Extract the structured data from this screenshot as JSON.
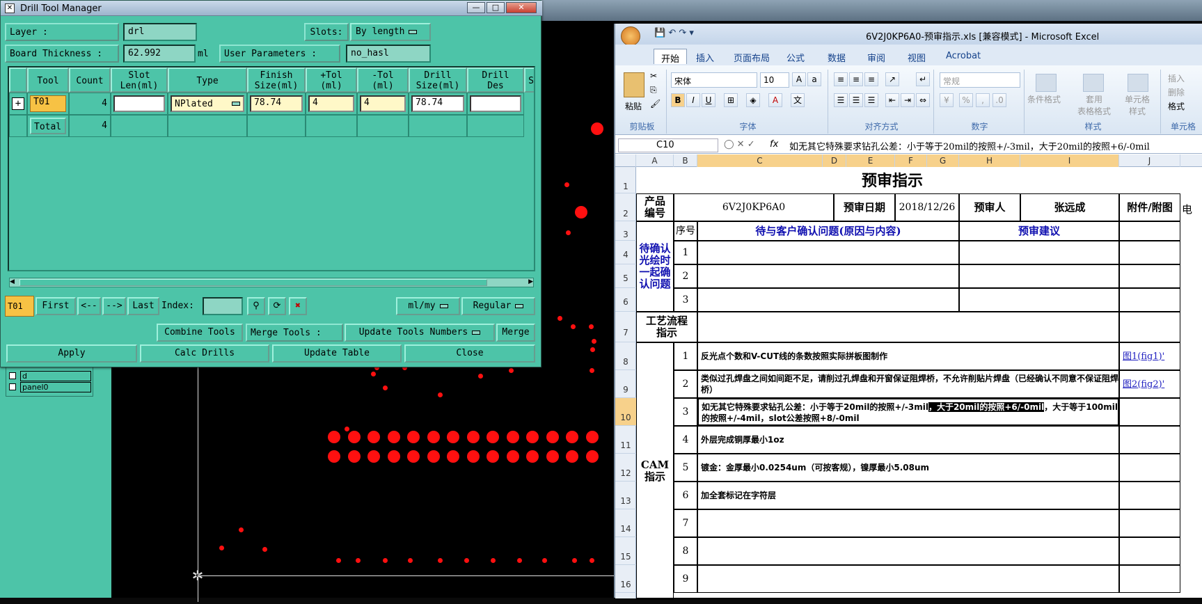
{
  "drill": {
    "title": "Drill Tool Manager",
    "minimize": "—",
    "maximize": "□",
    "close": "✕",
    "layer_label": "Layer        :",
    "layer_value": "drl",
    "slots_label": "Slots:",
    "slots_value": "By length",
    "thickness_label": "Board Thickness :",
    "thickness_value": "62.992",
    "thickness_unit": "ml",
    "userparams_label": "User Parameters :",
    "userparams_value": "no_hasl",
    "columns": [
      "Tool",
      "Count",
      "Slot\nLen(ml)",
      "Type",
      "Finish\nSize(ml)",
      "+Tol\n(ml)",
      "-Tol\n(ml)",
      "Drill\nSize(ml)",
      "Drill\nDes",
      "S"
    ],
    "row1": {
      "tool": "T01",
      "count": "4",
      "slot_len": "",
      "type": "NPlated",
      "finish": "78.74",
      "ptol": "4",
      "mtol": "4",
      "drill": "78.74",
      "des": ""
    },
    "total_label": "Total",
    "total_count": "4",
    "current": "T01",
    "first": "First",
    "prev": "<--",
    "next": "-->",
    "last": "Last",
    "index_label": "Index:",
    "units": "ml/my",
    "mode": "Regular",
    "combine": "Combine Tools",
    "merge_label": "Merge Tools :",
    "update_numbers": "Update Tools Numbers",
    "merge": "Merge",
    "apply": "Apply",
    "calc": "Calc Drills",
    "update_table": "Update Table",
    "close_btn": "Close"
  },
  "layers": {
    "items": [
      "d",
      "panel0"
    ]
  },
  "excel": {
    "title": "6V2J0KP6A0-预审指示.xls  [兼容模式] - Microsoft Excel",
    "tabs": [
      "开始",
      "插入",
      "页面布局",
      "公式",
      "数据",
      "审阅",
      "视图",
      "Acrobat"
    ],
    "font": "宋体",
    "size": "10",
    "number_format": "常规",
    "groups": [
      "剪贴板",
      "字体",
      "对齐方式",
      "数字",
      "样式",
      "单元格"
    ],
    "paste": "粘贴",
    "cond_format": "条件格式",
    "table_format": "套用\n表格格式",
    "cell_style": "单元格\n样式",
    "insert": "插入",
    "delete": "删除",
    "format": "格式",
    "e_label": "电",
    "name_box": "C10",
    "fx": "fx",
    "formula": "如无其它特殊要求钻孔公差：小于等于20mil的按照+/-3mil，大于20mil的按照+6/-0mil",
    "cols": [
      "A",
      "B",
      "C",
      "D",
      "E",
      "F",
      "G",
      "H",
      "I",
      "J"
    ],
    "rows": [
      "1",
      "2",
      "3",
      "4",
      "5",
      "6",
      "7",
      "8",
      "9",
      "10",
      "11",
      "12",
      "13",
      "14",
      "15",
      "16"
    ],
    "sheet": {
      "heading": "预审指示",
      "product_label": "产品\n编号",
      "product_no": "6V2J0KP6A0",
      "date_label": "预审日期",
      "date": "2018/12/26",
      "reviewer_label": "预审人",
      "reviewer": "张远成",
      "attach_label": "附件/附图",
      "seq": "序号",
      "question": "待与客户确认问题(原因与内容)",
      "suggestion": "预审建议",
      "pending": "待确认\n光绘时\n一起确\n认问题",
      "process": "工艺流程\n指示",
      "cam": "CAM\n指示",
      "items": [
        {
          "n": "1",
          "text": "反光点个数和V-CUT线的条数按照实际拼板图制作",
          "link": "图1(fig1)'"
        },
        {
          "n": "2",
          "text": "类似过孔焊盘之间如间距不足，请削过孔焊盘和开窗保证阻焊桥，不允许削贴片焊盘（已经确认不同意不保证阻焊桥）",
          "link": "图2(fig2)'"
        },
        {
          "n": "3",
          "text_a": "如无其它特殊要求钻孔公差：小于等于20mil的按照+/-3mil",
          "text_b": "，大于20mil的按照+6/-0mil",
          "text_c": "，大于等于100mil的按照+/-4mil，slot公差按照+8/-0mil"
        },
        {
          "n": "4",
          "text": "外层完成铜厚最小1oz"
        },
        {
          "n": "5",
          "text": "镀金：金厚最小0.0254um（可按客规），镍厚最小5.08um"
        },
        {
          "n": "6",
          "text": "加全套标记在字符层"
        },
        {
          "n": "7"
        },
        {
          "n": "8"
        },
        {
          "n": "9"
        }
      ],
      "pre_items": [
        "1",
        "2",
        "3"
      ]
    }
  }
}
